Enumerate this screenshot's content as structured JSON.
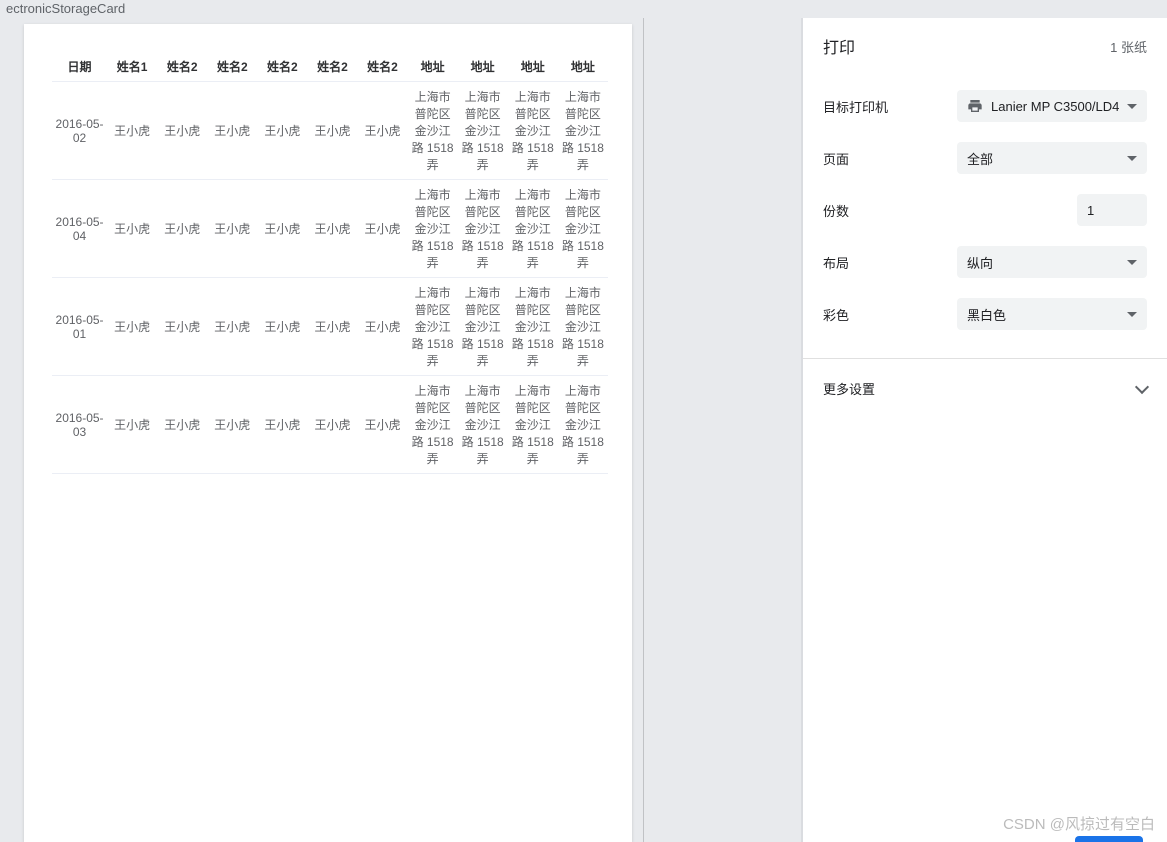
{
  "window_title": "ectronicStorageCard",
  "print": {
    "title": "打印",
    "sheet_count": "1 张纸",
    "labels": {
      "target_printer": "目标打印机",
      "pages": "页面",
      "copies": "份数",
      "layout": "布局",
      "color": "彩色",
      "more_settings": "更多设置"
    },
    "values": {
      "printer": "Lanier MP C3500/LD4",
      "pages": "全部",
      "copies": "1",
      "layout": "纵向",
      "color": "黑白色"
    }
  },
  "table": {
    "headers": [
      "日期",
      "姓名1",
      "姓名2",
      "姓名2",
      "姓名2",
      "姓名2",
      "姓名2",
      "地址",
      "地址",
      "地址",
      "地址"
    ],
    "rows": [
      {
        "date": "2016-05-02",
        "names": [
          "王小虎",
          "王小虎",
          "王小虎",
          "王小虎",
          "王小虎",
          "王小虎"
        ],
        "addrs": [
          "上海市普陀区金沙江路 1518 弄",
          "上海市普陀区金沙江路 1518 弄",
          "上海市普陀区金沙江路 1518 弄",
          "上海市普陀区金沙江路 1518 弄"
        ]
      },
      {
        "date": "2016-05-04",
        "names": [
          "王小虎",
          "王小虎",
          "王小虎",
          "王小虎",
          "王小虎",
          "王小虎"
        ],
        "addrs": [
          "上海市普陀区金沙江路 1518 弄",
          "上海市普陀区金沙江路 1518 弄",
          "上海市普陀区金沙江路 1518 弄",
          "上海市普陀区金沙江路 1518 弄"
        ]
      },
      {
        "date": "2016-05-01",
        "names": [
          "王小虎",
          "王小虎",
          "王小虎",
          "王小虎",
          "王小虎",
          "王小虎"
        ],
        "addrs": [
          "上海市普陀区金沙江路 1518 弄",
          "上海市普陀区金沙江路 1518 弄",
          "上海市普陀区金沙江路 1518 弄",
          "上海市普陀区金沙江路 1518 弄"
        ]
      },
      {
        "date": "2016-05-03",
        "names": [
          "王小虎",
          "王小虎",
          "王小虎",
          "王小虎",
          "王小虎",
          "王小虎"
        ],
        "addrs": [
          "上海市普陀区金沙江路 1518 弄",
          "上海市普陀区金沙江路 1518 弄",
          "上海市普陀区金沙江路 1518 弄",
          "上海市普陀区金沙江路 1518 弄"
        ]
      }
    ]
  },
  "watermark": "CSDN @风掠过有空白"
}
